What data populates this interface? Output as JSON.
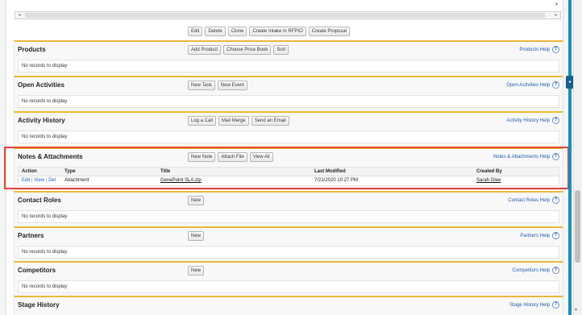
{
  "top_buttons": [
    "Edit",
    "Delete",
    "Clone",
    "Create Intake in RFPIO",
    "Create Proposal"
  ],
  "sections": {
    "products": {
      "title": "Products",
      "buttons": [
        "Add Product",
        "Choose Price Book",
        "Sort"
      ],
      "help": "Products Help",
      "empty": "No records to display"
    },
    "open_activities": {
      "title": "Open Activities",
      "buttons": [
        "New Task",
        "New Event"
      ],
      "help": "Open Activities Help",
      "empty": "No records to display"
    },
    "activity_history": {
      "title": "Activity History",
      "buttons": [
        "Log a Call",
        "Mail Merge",
        "Send an Email"
      ],
      "help": "Activity History Help",
      "empty": "No records to display"
    },
    "notes": {
      "title": "Notes & Attachments",
      "buttons": [
        "New Note",
        "Attach File",
        "View All"
      ],
      "help": "Notes & Attachments Help",
      "columns": [
        "Action",
        "Type",
        "Title",
        "Last Modified",
        "Created By"
      ],
      "row": {
        "action_edit": "Edit",
        "sep1": "|",
        "action_view": "View",
        "sep2": "|",
        "action_del": "Del",
        "type": "Attachment",
        "title": "GenePoint SLA.zip",
        "last_modified": "7/21/2020 10:27 PM",
        "created_by": "Sarah Glee"
      }
    },
    "contact_roles": {
      "title": "Contact Roles",
      "buttons": [
        "New"
      ],
      "help": "Contact Roles Help",
      "empty": "No records to display"
    },
    "partners": {
      "title": "Partners",
      "buttons": [
        "New"
      ],
      "help": "Partners Help",
      "empty": "No records to display"
    },
    "competitors": {
      "title": "Competitors",
      "buttons": [
        "New"
      ],
      "help": "Competitors Help",
      "empty": "No records to display"
    },
    "stage_history": {
      "title": "Stage History",
      "help": "Stage History Help"
    }
  },
  "help_icon_glyph": "?",
  "colors": {
    "section_accent": "#e9b83b",
    "highlight": "#e0453a",
    "link": "#1a5eb3",
    "teal_bar": "#1a8fb5"
  },
  "icons": {
    "scroll_left": "◂",
    "scroll_right": "▸",
    "scroll_up": "▾",
    "scroll_down": "▾",
    "side_tab": "◂"
  }
}
